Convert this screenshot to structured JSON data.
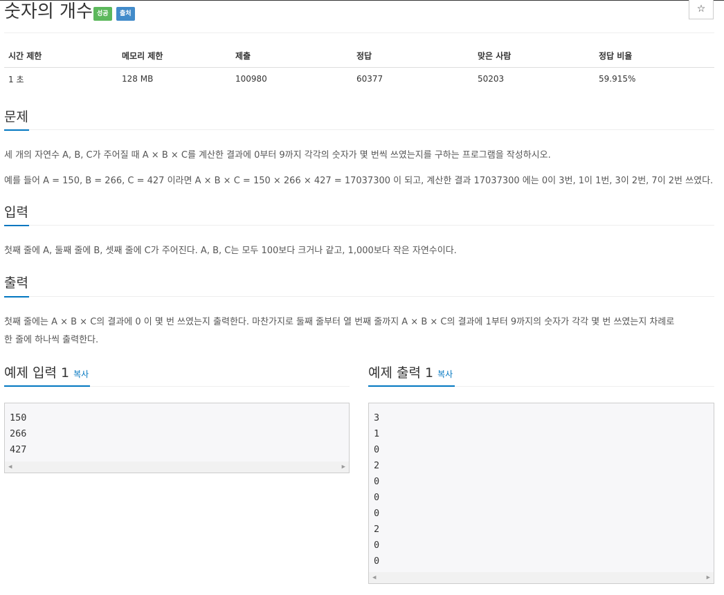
{
  "problem": {
    "title": "숫자의 개수",
    "labels": {
      "success": "성공",
      "source": "출처"
    },
    "star_icon": "☆"
  },
  "info_table": {
    "headers": [
      "시간 제한",
      "메모리 제한",
      "제출",
      "정답",
      "맞은 사람",
      "정답 비율"
    ],
    "row": [
      "1 초",
      "128 MB",
      "100980",
      "60377",
      "50203",
      "59.915%"
    ]
  },
  "sections": {
    "description": {
      "title": "문제",
      "paragraphs": [
        "세 개의 자연수 A, B, C가 주어질 때 A × B × C를 계산한 결과에 0부터 9까지 각각의 숫자가 몇 번씩 쓰였는지를 구하는 프로그램을 작성하시오.",
        "예를 들어 A = 150, B = 266, C = 427 이라면 A × B × C = 150 × 266 × 427 = 17037300 이 되고, 계산한 결과 17037300 에는 0이 3번, 1이 1번, 3이 2번, 7이 2번 쓰였다."
      ]
    },
    "input": {
      "title": "입력",
      "paragraphs": [
        "첫째 줄에 A, 둘째 줄에 B, 셋째 줄에 C가 주어진다. A, B, C는 모두 100보다 크거나 같고, 1,000보다 작은 자연수이다."
      ]
    },
    "output": {
      "title": "출력",
      "paragraphs": [
        "첫째 줄에는 A × B × C의 결과에 0 이 몇 번 쓰였는지 출력한다. 마찬가지로 둘째 줄부터 열 번째 줄까지 A × B × C의 결과에 1부터 9까지의 숫자가 각각 몇 번 쓰였는지 차례로",
        "한 줄에 하나씩 출력한다."
      ]
    }
  },
  "samples": {
    "input": {
      "title": "예제 입력 1",
      "copy_label": "복사",
      "lines": [
        "150",
        "266",
        "427"
      ]
    },
    "output": {
      "title": "예제 출력 1",
      "copy_label": "복사",
      "lines": [
        "3",
        "1",
        "0",
        "2",
        "0",
        "0",
        "0",
        "2",
        "0",
        "0"
      ]
    }
  }
}
